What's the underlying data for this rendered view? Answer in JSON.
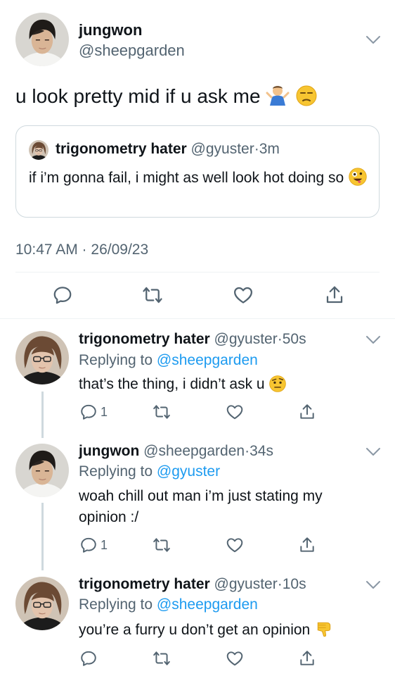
{
  "main_tweet": {
    "name": "jungwon",
    "handle": "@sheepgarden",
    "text": "u look pretty mid if u ask me",
    "emojis": [
      "person-shrugging",
      "unamused-face"
    ],
    "quote": {
      "name": "trigonometry hater",
      "handle": "@gyuster",
      "time": "3m",
      "text": "if i’m gonna fail, i might as well look hot doing so",
      "emoji": "zany-face"
    },
    "timestamp": "10:47 AM · 26/09/23",
    "actions": [
      "reply-icon",
      "retweet-icon",
      "like-icon",
      "share-icon"
    ]
  },
  "replies": [
    {
      "name": "trigonometry hater",
      "handle": "@gyuster",
      "time": "50s",
      "replying_label": "Replying to",
      "replying_to": "@sheepgarden",
      "text": "that’s the thing, i didn’t ask u",
      "emoji": "face-with-raised-eyebrow",
      "reply_count": "1"
    },
    {
      "name": "jungwon",
      "handle": "@sheepgarden",
      "time": "34s",
      "replying_label": "Replying to",
      "replying_to": "@gyuster",
      "text": "woah chill out man i’m just stating my opinion :/",
      "emoji": "",
      "reply_count": "1"
    },
    {
      "name": "trigonometry hater",
      "handle": "@gyuster",
      "time": "10s",
      "replying_label": "Replying to",
      "replying_to": "@sheepgarden",
      "text": "you’re a furry u don’t get an opinion",
      "emoji": "thumbs-down",
      "reply_count": ""
    }
  ],
  "colors": {
    "text": "#0f1419",
    "muted": "#536471",
    "link": "#1d9bf0",
    "border": "#cfd9de"
  }
}
